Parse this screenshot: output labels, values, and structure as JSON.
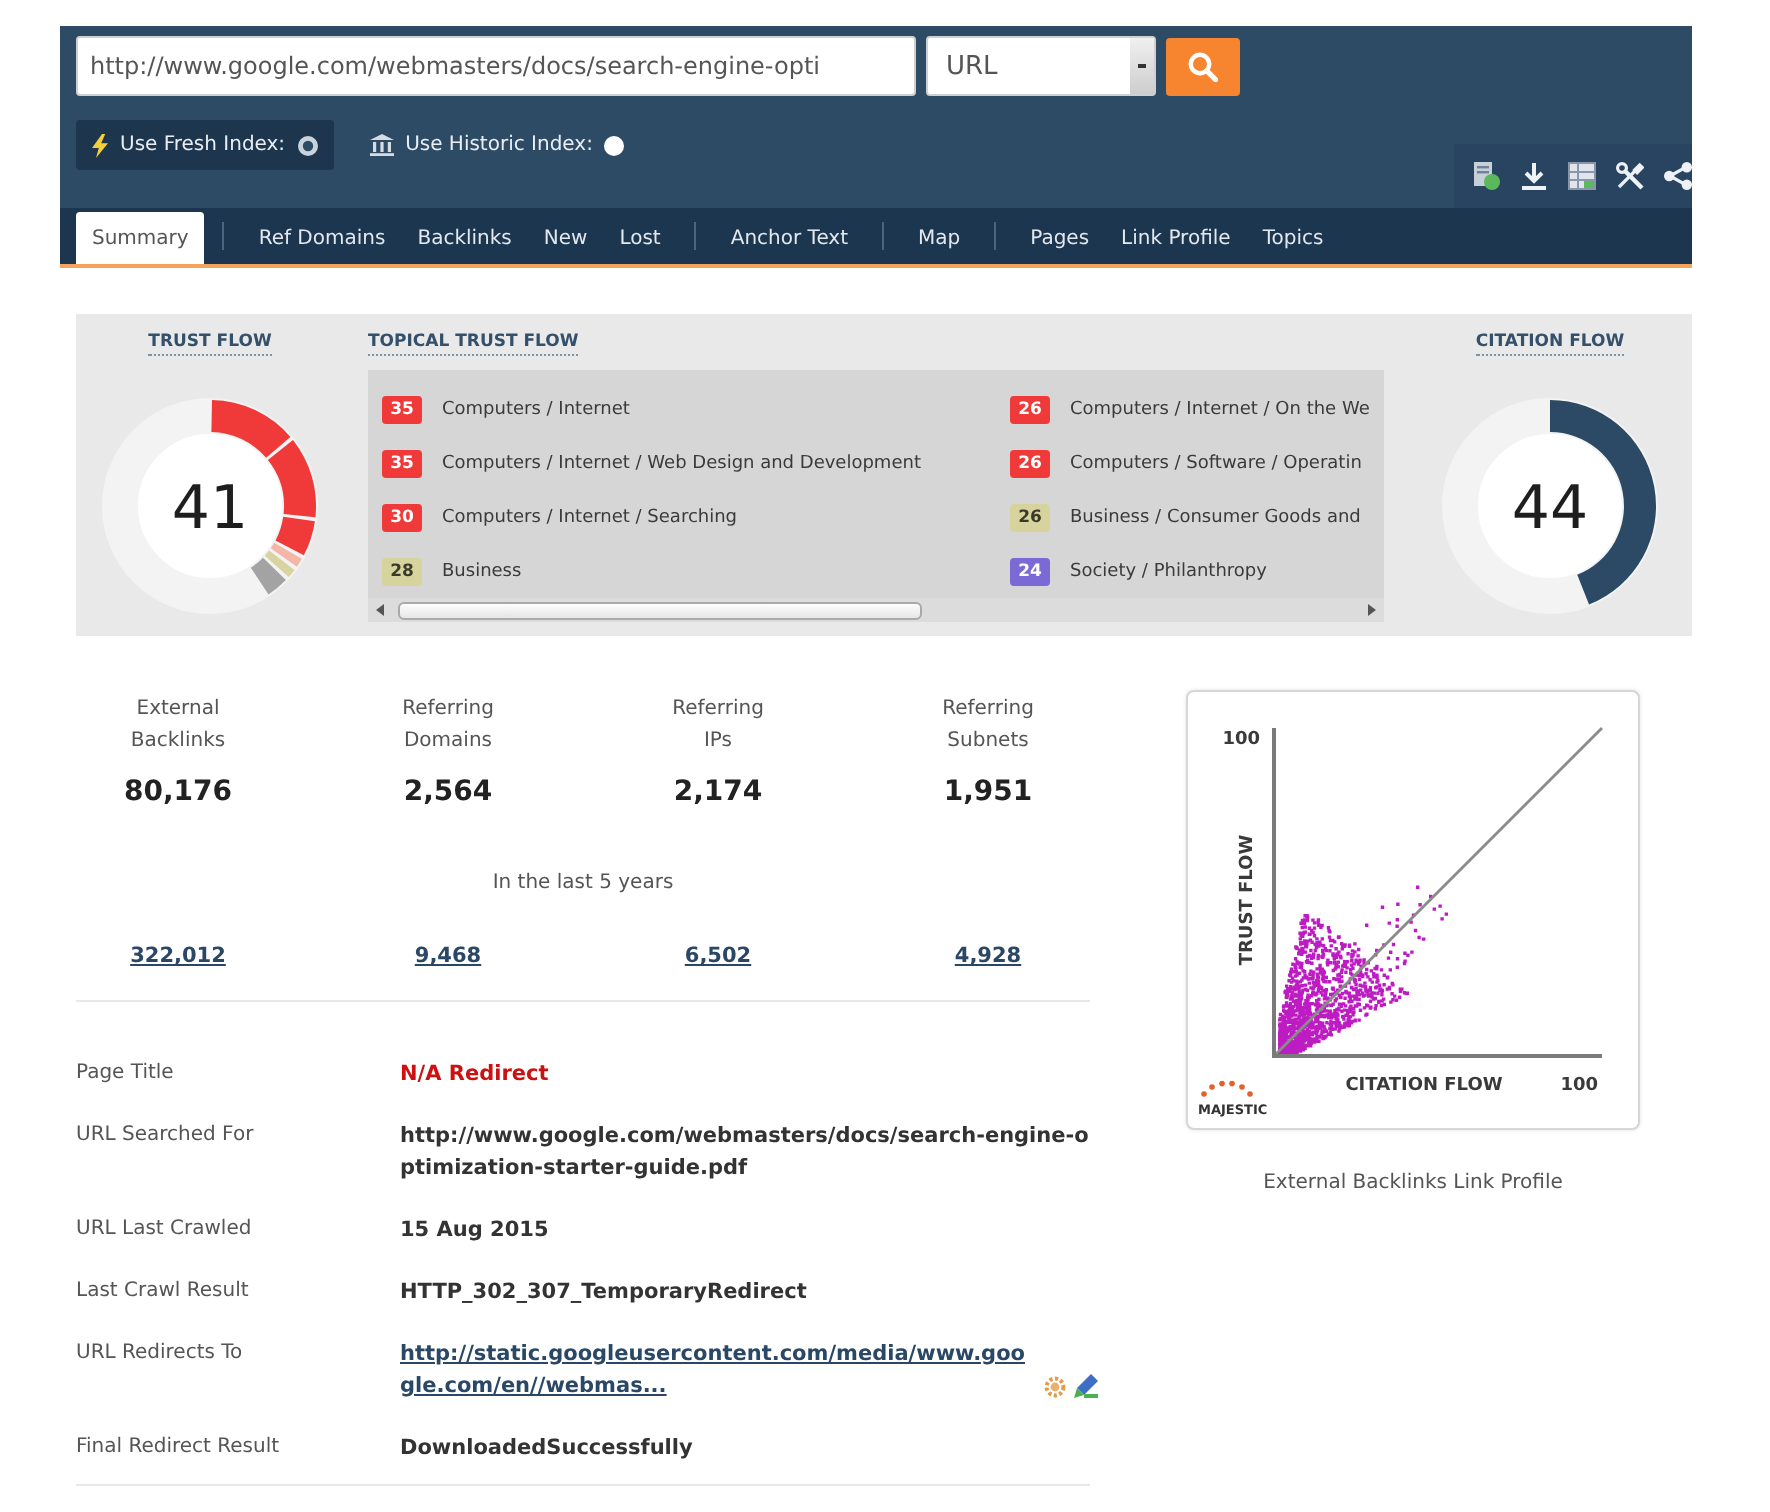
{
  "search": {
    "value": "http://www.google.com/webmasters/docs/search-engine-opti",
    "type": "URL"
  },
  "index_options": [
    {
      "kind": "fresh",
      "label": "Use Fresh Index:",
      "selected": true
    },
    {
      "kind": "historic",
      "label": "Use Historic Index:",
      "selected": false
    }
  ],
  "tab_groups": [
    {
      "items": [
        {
          "label": "Summary",
          "selected": true
        }
      ]
    },
    {
      "items": [
        {
          "label": "Ref Domains",
          "selected": false
        },
        {
          "label": "Backlinks",
          "selected": false
        },
        {
          "label": "New",
          "selected": false
        },
        {
          "label": "Lost",
          "selected": false
        }
      ]
    },
    {
      "items": [
        {
          "label": "Anchor Text",
          "selected": false
        }
      ]
    },
    {
      "items": [
        {
          "label": "Map",
          "selected": false
        }
      ]
    },
    {
      "items": [
        {
          "label": "Pages",
          "selected": false
        },
        {
          "label": "Link Profile",
          "selected": false
        },
        {
          "label": "Topics",
          "selected": false
        }
      ]
    }
  ],
  "trust_flow": {
    "title": "TRUST FLOW",
    "value": "41"
  },
  "topical_trust_flow": {
    "title": "TOPICAL TRUST FLOW",
    "topics": [
      {
        "score": "35",
        "label": "Computers / Internet",
        "color": "#f03a3a"
      },
      {
        "score": "35",
        "label": "Computers / Internet / Web Design and Development",
        "color": "#f03a3a"
      },
      {
        "score": "30",
        "label": "Computers / Internet / Searching",
        "color": "#f03a3a"
      },
      {
        "score": "28",
        "label": "Business",
        "color": "#d6d49c"
      },
      {
        "score": "26",
        "label": "Computers / Internet / On the We",
        "color": "#f03a3a"
      },
      {
        "score": "26",
        "label": "Computers / Software / Operatin",
        "color": "#f03a3a"
      },
      {
        "score": "26",
        "label": "Business / Consumer Goods and",
        "color": "#d6d49c"
      },
      {
        "score": "24",
        "label": "Society / Philanthropy",
        "color": "#7b6ad6"
      }
    ]
  },
  "citation_flow": {
    "title": "CITATION FLOW",
    "value": "44",
    "level": 0.44
  },
  "stats": [
    {
      "label": "External Backlinks",
      "value": "80,176"
    },
    {
      "label": "Referring Domains",
      "value": "2,564"
    },
    {
      "label": "Referring IPs",
      "value": "2,174"
    },
    {
      "label": "Referring Subnets",
      "value": "1,951"
    }
  ],
  "history": {
    "caption": "In the last 5 years",
    "links": [
      "322,012",
      "9,468",
      "6,502",
      "4,928"
    ]
  },
  "details": [
    {
      "label": "Page Title",
      "value": "N/A Redirect",
      "kind": "alert"
    },
    {
      "label": "URL Searched For",
      "value": "http://www.google.com/webmasters/docs/search-engine-optimization-starter-guide.pdf",
      "kind": "text"
    },
    {
      "label": "URL Last Crawled",
      "value": "15 Aug 2015",
      "kind": "text"
    },
    {
      "label": "Last Crawl Result",
      "value": "HTTP_302_307_TemporaryRedirect",
      "kind": "text"
    },
    {
      "label": "URL Redirects To",
      "value": "http://static.googleusercontent.com/media/www.google.com/en//webmas...",
      "kind": "link"
    },
    {
      "label": "Final Redirect Result",
      "value": "DownloadedSuccessfully",
      "kind": "text"
    }
  ],
  "chart": {
    "y_tick": "100",
    "y_title": "TRUST FLOW",
    "x_title": "CITATION FLOW",
    "x_tick": "100",
    "logo": "MAJESTIC",
    "caption": "External Backlinks Link Profile"
  }
}
